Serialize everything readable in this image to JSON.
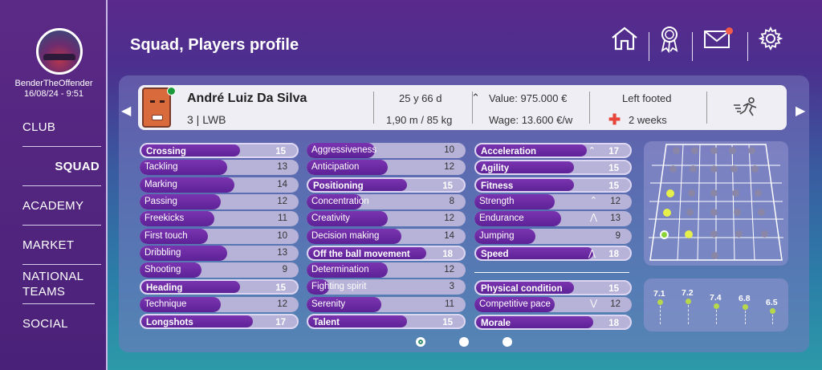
{
  "user": {
    "name": "BenderTheOffender",
    "datetime": "16/08/24 - 9:51"
  },
  "nav": [
    {
      "label": "CLUB",
      "active": false
    },
    {
      "label": "SQUAD",
      "active": true
    },
    {
      "label": "ACADEMY",
      "active": false
    },
    {
      "label": "MARKET",
      "active": false
    },
    {
      "label": "NATIONAL TEAMS",
      "active": false
    },
    {
      "label": "SOCIAL",
      "active": false
    }
  ],
  "header": {
    "title": "Squad, Players profile"
  },
  "player": {
    "name": "André Luiz Da Silva",
    "number_pos": "3 | LWB",
    "age": "25 y 66 d",
    "height_weight": "1,90 m / 85 kg",
    "value": "Value: 975.000 €",
    "wage": "Wage: 13.600 €/w",
    "foot": "Left footed",
    "injury": "2 weeks"
  },
  "attributes": {
    "col1": [
      {
        "label": "Crossing",
        "value": "15",
        "strong": true
      },
      {
        "label": "Tackling",
        "value": "13",
        "strong": false
      },
      {
        "label": "Marking",
        "value": "14",
        "strong": false
      },
      {
        "label": "Passing",
        "value": "12",
        "strong": false
      },
      {
        "label": "Freekicks",
        "value": "11",
        "strong": false
      },
      {
        "label": "First touch",
        "value": "10",
        "strong": false
      },
      {
        "label": "Dribbling",
        "value": "13",
        "strong": false
      },
      {
        "label": "Shooting",
        "value": "9",
        "strong": false
      },
      {
        "label": "Heading",
        "value": "15",
        "strong": true
      },
      {
        "label": "Technique",
        "value": "12",
        "strong": false
      },
      {
        "label": "Longshots",
        "value": "17",
        "strong": true
      }
    ],
    "col2": [
      {
        "label": "Aggressiveness",
        "value": "10",
        "strong": false
      },
      {
        "label": "Anticipation",
        "value": "12",
        "strong": false
      },
      {
        "label": "Positioning",
        "value": "15",
        "strong": true
      },
      {
        "label": "Concentration",
        "value": "8",
        "strong": false
      },
      {
        "label": "Creativity",
        "value": "12",
        "strong": false
      },
      {
        "label": "Decision making",
        "value": "14",
        "strong": false
      },
      {
        "label": "Off the ball movement",
        "value": "18",
        "strong": true
      },
      {
        "label": "Determination",
        "value": "12",
        "strong": false
      },
      {
        "label": "Fighting spirit",
        "value": "3",
        "strong": false
      },
      {
        "label": "Serenity",
        "value": "11",
        "strong": false
      },
      {
        "label": "Talent",
        "value": "15",
        "strong": true
      }
    ],
    "col3": [
      {
        "label": "Acceleration",
        "value": "17",
        "strong": true,
        "trend": "^"
      },
      {
        "label": "Agility",
        "value": "15",
        "strong": true,
        "trend": ""
      },
      {
        "label": "Fitness",
        "value": "15",
        "strong": true,
        "trend": ""
      },
      {
        "label": "Strength",
        "value": "12",
        "strong": false,
        "trend": "^"
      },
      {
        "label": "Endurance",
        "value": "13",
        "strong": false,
        "trend": "^^"
      },
      {
        "label": "Jumping",
        "value": "9",
        "strong": false,
        "trend": ""
      },
      {
        "label": "Speed",
        "value": "18",
        "strong": true,
        "trend": "^^"
      }
    ],
    "col3b": [
      {
        "label": "Physical condition",
        "value": "15",
        "strong": true,
        "trend": ""
      },
      {
        "label": "Competitive pace",
        "value": "12",
        "strong": false,
        "trend": "vv"
      },
      {
        "label": "Morale",
        "value": "18",
        "strong": true,
        "trend": ""
      }
    ]
  },
  "ratings": [
    "7.1",
    "7.2",
    "7.4",
    "6.8",
    "6.5"
  ],
  "colors": {
    "accent": "#6a2aa0",
    "sidebar": "#5b2a86"
  }
}
